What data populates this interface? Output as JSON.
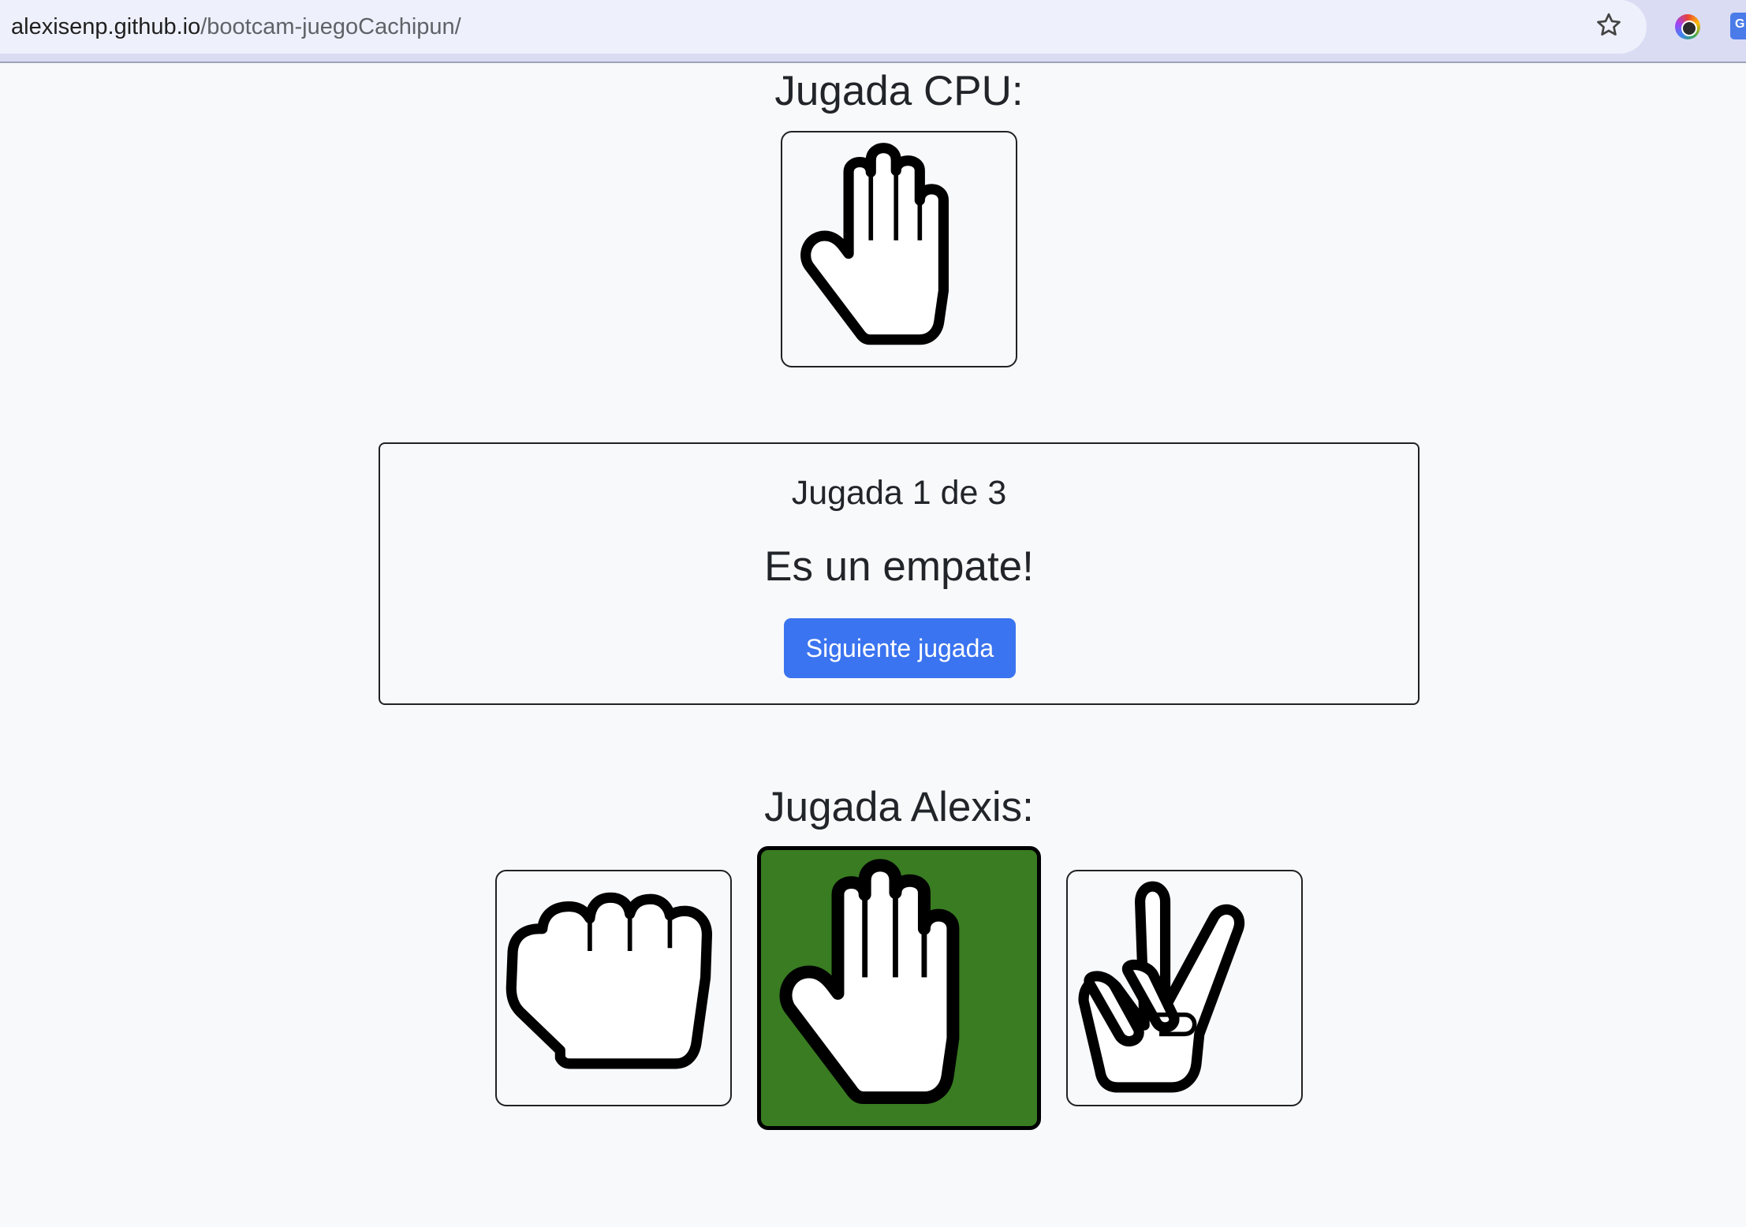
{
  "browser": {
    "url_host": "alexisenp.github.io",
    "url_path": "/bootcam-juegoCachipun/",
    "extension_icon_2_letter": "G"
  },
  "cpu": {
    "heading": "Jugada CPU:",
    "choice_icon": "paper-hand-icon"
  },
  "result": {
    "round_label": "Jugada 1 de 3",
    "message": "Es un empate!",
    "next_button_label": "Siguiente jugada"
  },
  "player": {
    "heading": "Jugada Alexis:",
    "options": [
      {
        "icon": "rock-fist-icon",
        "selected": false
      },
      {
        "icon": "paper-hand-icon",
        "selected": true
      },
      {
        "icon": "scissors-hand-icon",
        "selected": false
      }
    ]
  },
  "colors": {
    "selected_background": "#397c22",
    "button_primary": "#3b74f0",
    "page_background": "#f8f9fb"
  }
}
